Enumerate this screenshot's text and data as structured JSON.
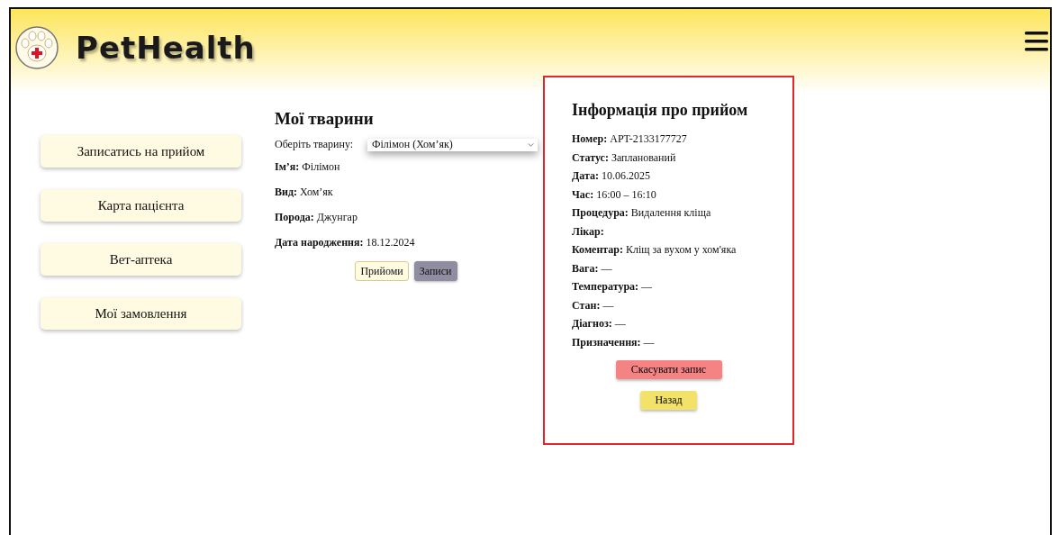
{
  "header": {
    "logo_text": "PetHealth"
  },
  "sidebar": {
    "items": [
      {
        "label": "Записатись на прийом"
      },
      {
        "label": "Карта пацієнта"
      },
      {
        "label": "Вет-аптека"
      },
      {
        "label": "Мої замовлення"
      }
    ]
  },
  "pets": {
    "title": "Мої тварини",
    "select_label": "Оберіть тварину:",
    "select_value": "Філімон (Хом’як)",
    "fields": [
      {
        "label": "Ім’я:",
        "value": "Філімон"
      },
      {
        "label": "Вид:",
        "value": "Хом’як"
      },
      {
        "label": "Порода:",
        "value": "Джунгар"
      },
      {
        "label": "Дата народження:",
        "value": "18.12.2024"
      }
    ],
    "tabs": [
      {
        "label": "Прийоми",
        "selected": true
      },
      {
        "label": "Записи",
        "selected": false
      }
    ]
  },
  "appointment": {
    "title": "Інформація про прийом",
    "lines": [
      "**Номер:** APT-2133177727",
      "**Статус:** Запланований",
      "**Дата:** 10.06.2025",
      "**Час:** 16:00 – 16:10",
      "**Процедура:** Видалення кліща",
      "**Лікар:**",
      "**Коментар:** Кліщ за вухом у хом'яка",
      "**Вага:** —",
      "**Температура:** —",
      "**Стан:** —",
      "**Діагноз:** —",
      "**Призначення:** —"
    ],
    "cancel_button": "Скасувати запис",
    "back_button": "Назад"
  }
}
